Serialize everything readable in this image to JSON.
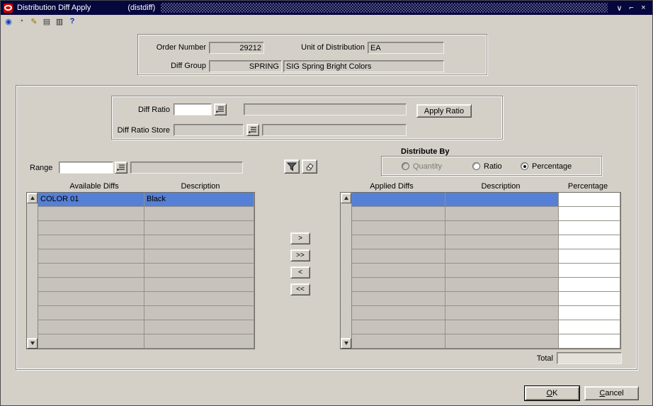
{
  "colors": {
    "titlebar": "#07073f",
    "selection": "#567fd6",
    "window_bg": "#d4d0c8"
  },
  "window": {
    "title": "Distribution Diff Apply",
    "subtitle": "(distdiff)",
    "minimize": "∨",
    "maximize": "⌐",
    "close": "×"
  },
  "toolbar": {
    "icons": [
      {
        "name": "globe-icon",
        "glyph": "◉"
      },
      {
        "name": "clock-icon",
        "glyph": "◔"
      },
      {
        "name": "edit-icon",
        "glyph": "✎"
      },
      {
        "name": "clipboard-icon",
        "glyph": "▤"
      },
      {
        "name": "print-icon",
        "glyph": "▥"
      },
      {
        "name": "help-icon",
        "glyph": "?"
      }
    ]
  },
  "header": {
    "order_number_label": "Order Number",
    "order_number": "29212",
    "unit_of_distribution_label": "Unit of Distribution",
    "unit_of_distribution": "EA",
    "diff_group_label": "Diff Group",
    "diff_group": "SPRING",
    "diff_group_description": "SIG Spring Bright Colors"
  },
  "ratio": {
    "diff_ratio_label": "Diff Ratio",
    "diff_ratio_value": "",
    "diff_ratio_description": "",
    "apply_ratio_label": "Apply Ratio",
    "diff_ratio_store_label": "Diff Ratio Store",
    "diff_ratio_store_value": "",
    "diff_ratio_store_description": ""
  },
  "range": {
    "label": "Range",
    "value": "",
    "description": ""
  },
  "distribute_by": {
    "title": "Distribute By",
    "options": [
      {
        "label": "Quantity",
        "selected": false,
        "enabled": false
      },
      {
        "label": "Ratio",
        "selected": false,
        "enabled": true
      },
      {
        "label": "Percentage",
        "selected": true,
        "enabled": true
      }
    ]
  },
  "available_table": {
    "headers": [
      "Available Diffs",
      "Description"
    ],
    "rows": [
      {
        "diff": "COLOR 01",
        "description": "Black",
        "selected": true
      }
    ]
  },
  "applied_table": {
    "headers": [
      "Applied Diffs",
      "Description",
      "Percentage"
    ],
    "rows": [],
    "selected_row_index": 0
  },
  "transfer_buttons": [
    ">",
    ">>",
    "<",
    "<<"
  ],
  "total": {
    "label": "Total",
    "value": ""
  },
  "footer": {
    "ok_label": "OK",
    "cancel_label": "Cancel"
  }
}
